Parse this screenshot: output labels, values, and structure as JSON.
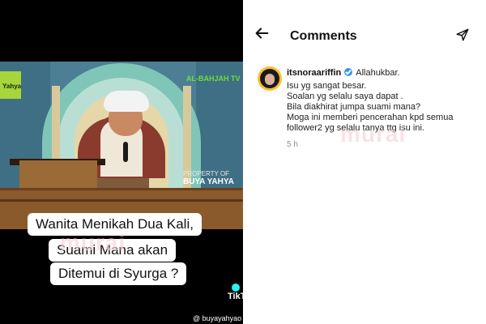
{
  "left_panel": {
    "channel_name": "AL-BAHJAH TV",
    "logo_text": "Yahya",
    "watermark_property": "PROPERTY OF",
    "watermark_name": "BUYA YAHYA",
    "caption_lines": [
      "Wanita Menikah Dua Kali,",
      "Suami Mana akan",
      "Ditemui di Syurga ?"
    ],
    "murai_watermark": "murai",
    "tiktok_label": "TikT",
    "tiktok_handle": "@ buyayahyao"
  },
  "right_panel": {
    "header": {
      "title": "Comments",
      "back_icon": "arrow-left-icon",
      "send_icon": "paper-plane-icon"
    },
    "comment": {
      "username": "itsnoraariffin",
      "verified": true,
      "first_text": "Allahukbar.",
      "lines": [
        "Isu yg sangat besar.",
        "Soalan yg selalu saya dapat .",
        "Bila diakhirat jumpa suami mana?",
        "Moga ini memberi pencerahan kpd semua",
        "follower2 yg selalu tanya ttg isu ini."
      ],
      "time": "5 h"
    },
    "murai_watermark": "murai"
  }
}
